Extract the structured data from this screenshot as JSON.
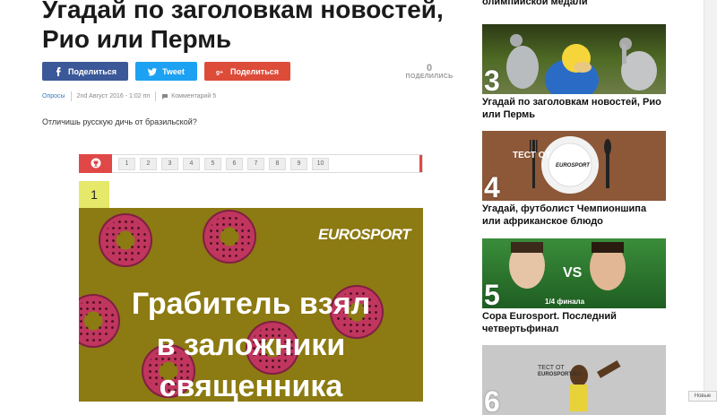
{
  "article": {
    "title": "Угадай по заголовкам новостей, Рио или Пермь",
    "share": {
      "facebook": "Поделиться",
      "twitter": "Tweet",
      "google": "Поделиться"
    },
    "share_count": "0",
    "share_count_label": "ПОДЕЛИЛИСЬ",
    "meta": {
      "category": "Опросы",
      "date": "2nd Август 2016 - 1:02 пп",
      "comments": "Комментарий 5"
    },
    "lead": "Отличишь русскую дичь от бразильской?",
    "quiz": {
      "pages": [
        "1",
        "2",
        "3",
        "4",
        "5",
        "6",
        "7",
        "8",
        "9",
        "10"
      ],
      "current": "1",
      "image_logo": "EUROSPORT",
      "image_text_line1": "Грабитель взял",
      "image_text_line2": "в заложники",
      "image_text_line3": "священника"
    }
  },
  "sidebar": {
    "top_text": "олимпийской медали",
    "cards": [
      {
        "rank": "3",
        "caption": "Угадай по заголовкам новостей, Рио или Пермь"
      },
      {
        "rank": "4",
        "caption": "Угадай, футболист Чемпионшипа или африканское блюдо",
        "img_text": "ТЕСТ ОТ",
        "img_logo": "EUROSPORT"
      },
      {
        "rank": "5",
        "caption": "Copa Eurosport. Последний четвертьфинал",
        "img_vs": "VS",
        "img_sub": "1/4 финала"
      },
      {
        "rank": "6",
        "caption": "",
        "img_text": "ТЕСТ ОТ",
        "img_logo": "EUROSPORT.RU"
      }
    ]
  },
  "footer_button": "Новые"
}
